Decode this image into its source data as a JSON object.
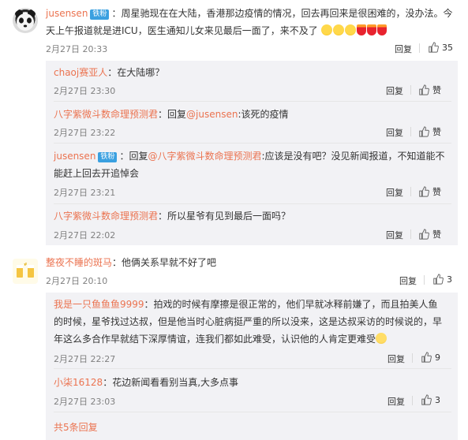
{
  "comments": [
    {
      "user": "jusensen",
      "badge": "铁粉",
      "text_line1": "：周星驰现在在大陆，香港那边疫情的情况，回去再回来是很困难的，没办法。今",
      "text_line2": "天上午报道就是进ICU，医生通知儿女来见最后一面了，来不及了",
      "time": "2月27日 20:33",
      "reply": "回复",
      "likes": "35"
    },
    {
      "user": "整夜不睡的斑马",
      "text": "：他俩关系早就不好了吧",
      "time": "2月27日 20:10",
      "reply": "回复",
      "likes": "3"
    }
  ],
  "replies1": [
    {
      "user": "chaoj赛亚人",
      "text": "：在大陆哪？",
      "time": "2月27日 23:30",
      "reply": "回复",
      "like": "赞"
    },
    {
      "user": "八字紫微斗数命理预测君",
      "pre": "：回复",
      "mention": "@jusensen",
      "text": ":该死的疫情",
      "time": "2月27日 23:22",
      "reply": "回复",
      "like": "赞"
    },
    {
      "user": "jusensen",
      "badge": "铁粉",
      "pre": "：回复",
      "mention": "@八字紫微斗数命理预测君",
      "text": ":应该是没有吧？没见新闻报道，不知道能不",
      "text2": "能赶上回去开追悼会",
      "time": "2月27日 23:21",
      "reply": "回复",
      "like": "赞"
    },
    {
      "user": "八字紫微斗数命理预测君",
      "text": "：所以星爷有见到最后一面吗？",
      "time": "2月27日 22:02",
      "reply": "回复",
      "like": "赞"
    }
  ],
  "replies2": [
    {
      "user": "我是一只鱼鱼鱼9999",
      "text": "：拍戏的时候有摩擦是很正常的，他们早就冰释前嫌了，而且拍美人鱼",
      "text2": "的时候，星爷找过达叔，但是他当时心脏病挺严重的所以没来，这是达叔采访的时候说的，早",
      "text3": "年这么多合作早就结下深厚情谊，连我们都如此难受，认识他的人肯定更难受",
      "time": "2月27日 22:27",
      "reply": "回复",
      "likes": "9"
    },
    {
      "user": "小柒16128",
      "text": "：花边新闻看看别当真,大多点事",
      "time": "2月27日 23:03",
      "reply": "回复",
      "likes": "3"
    }
  ],
  "more_label": "共5条回复",
  "colors": {
    "username": "#eb7350",
    "reply_box": "#f2f2f5",
    "badge": "#3aa0e0"
  },
  "icons": {
    "like": "thumb-up-icon"
  }
}
